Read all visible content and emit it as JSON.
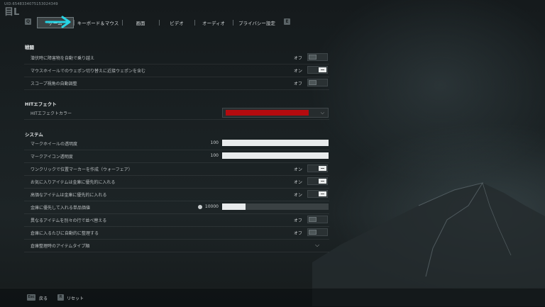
{
  "uid": "UID:6548334075153024349",
  "tabs": {
    "prev_key": "Q",
    "next_key": "E",
    "items": [
      {
        "label": "ゲーム",
        "active": true
      },
      {
        "label": "キーボード＆マウス",
        "active": false
      },
      {
        "label": "画面",
        "active": false
      },
      {
        "label": "ビデオ",
        "active": false
      },
      {
        "label": "オーディオ",
        "active": false
      },
      {
        "label": "プライバシー設定",
        "active": false
      }
    ]
  },
  "sections": {
    "combat": "戦闘",
    "hit_effect": "HITエフェクト",
    "system": "システム"
  },
  "combat": {
    "auto_vault": {
      "label": "潜伏時に障害物を自動で乗り越え",
      "state": "オフ"
    },
    "wheel_melee": {
      "label": "マウスホイールでのウェポン切り替えに近接ウェポンを含む",
      "state": "オン"
    },
    "scope_fov": {
      "label": "スコープ視角の自動調整",
      "state": "オフ"
    }
  },
  "hit": {
    "color": {
      "label": "HITエフェクトカラー",
      "value_color": "#b40b0f"
    }
  },
  "system": {
    "mark_wheel_opacity": {
      "label": "マークホイールの透明度",
      "value": "100",
      "fraction": 1.0
    },
    "mark_icon_opacity": {
      "label": "マークアイコン透明度",
      "value": "100",
      "fraction": 1.0
    },
    "one_click_marker": {
      "label": "ワンクリックで位置マーカーを作成（ウォーフェア）",
      "state": "オン"
    },
    "fav_to_stash": {
      "label": "お気に入りアイテムは金庫に優先的に入れる",
      "state": "オン"
    },
    "valuable_to_stash": {
      "label": "高価なアイテムは金庫に優先的に入れる",
      "state": "オン"
    },
    "stash_threshold": {
      "label": "金庫に優先して入れる単品価値",
      "value": "10000",
      "fraction": 0.22
    },
    "sort_rows": {
      "label": "異なるアイテムを別々の行で並べ替える",
      "state": "オフ"
    },
    "auto_sort": {
      "label": "倉庫に入るたびに自動的に整理する",
      "state": "オフ"
    },
    "sort_types": {
      "label": "倉庫整理時のアイテムタイプ順"
    }
  },
  "footer": {
    "back_key": "Esc",
    "back_label": "戻る",
    "reset_key": "R",
    "reset_label": "リセット"
  }
}
